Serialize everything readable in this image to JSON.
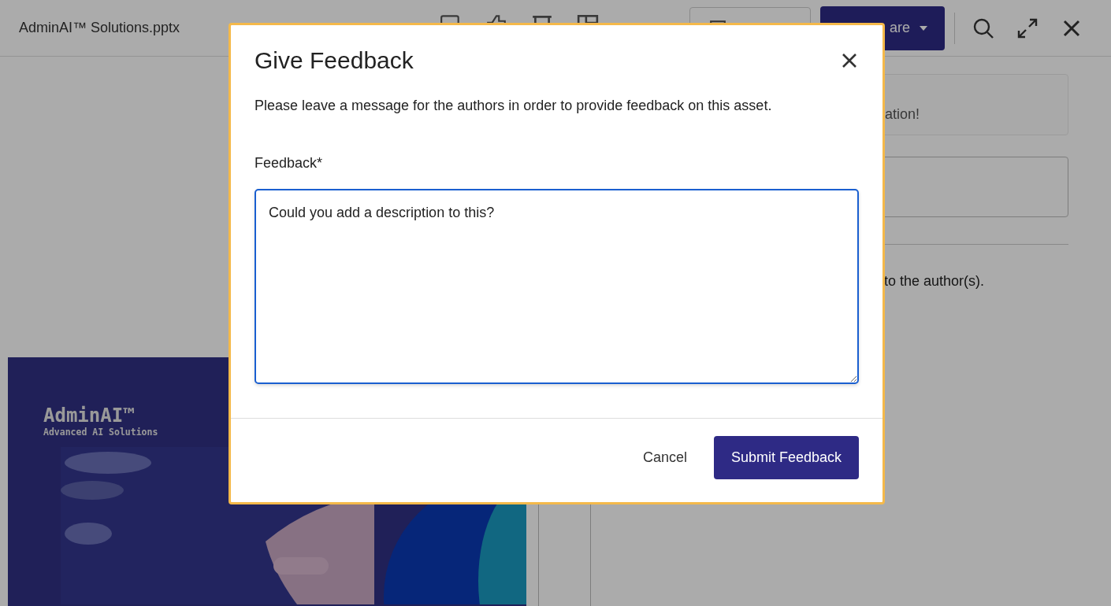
{
  "app_bar": {
    "file_name": "AdminAI™ Solutions.pptx",
    "share_button": {
      "label": "are"
    }
  },
  "right_panel": {
    "notice": "ation!",
    "closing_text": "to the author(s)."
  },
  "slide": {
    "title": "AdminAI™",
    "subtitle": "Advanced AI Solutions"
  },
  "dialog": {
    "title": "Give Feedback",
    "description": "Please leave a message for the authors in order to provide feedback on this asset.",
    "field_label": "Feedback*",
    "value": "Could you add a description to this?",
    "buttons": [
      {
        "label": "Cancel",
        "kind": "secondary"
      },
      {
        "label": "Submit Feedback",
        "kind": "primary"
      }
    ]
  }
}
